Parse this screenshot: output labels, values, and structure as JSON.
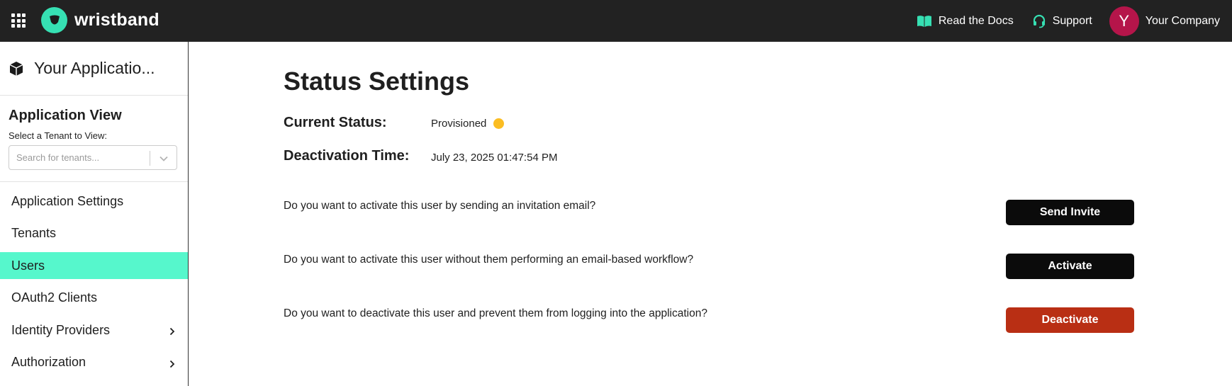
{
  "topbar": {
    "logo_text": "wristband",
    "links": [
      {
        "label": "Read the Docs",
        "icon": "book-icon"
      },
      {
        "label": "Support",
        "icon": "headset-icon"
      }
    ],
    "avatar_initial": "Y",
    "company_name": "Your Company",
    "avatar_color": "#b5154a",
    "accent_color": "#36e0b3"
  },
  "sidebar": {
    "app_name": "Your Applicatio...",
    "view_title": "Application View",
    "tenant_label": "Select a Tenant to View:",
    "tenant_placeholder": "Search for tenants...",
    "items": [
      {
        "label": "Application Settings",
        "active": false,
        "has_arrow": false
      },
      {
        "label": "Tenants",
        "active": false,
        "has_arrow": false
      },
      {
        "label": "Users",
        "active": true,
        "has_arrow": false
      },
      {
        "label": "OAuth2 Clients",
        "active": false,
        "has_arrow": false
      },
      {
        "label": "Identity Providers",
        "active": false,
        "has_arrow": true
      },
      {
        "label": "Authorization",
        "active": false,
        "has_arrow": true
      }
    ],
    "active_color": "#56f7cc"
  },
  "main": {
    "title": "Status Settings",
    "current_status_label": "Current Status:",
    "current_status_value": "Provisioned",
    "status_color": "#fbbd22",
    "deactivation_label": "Deactivation Time:",
    "deactivation_value": "July 23, 2025 01:47:54 PM",
    "actions": [
      {
        "question": "Do you want to activate this user by sending an invitation email?",
        "button": "Send Invite",
        "color": "#0b0b0b"
      },
      {
        "question": "Do you want to activate this user without them performing an email-based workflow?",
        "button": "Activate",
        "color": "#0b0b0b"
      },
      {
        "question": "Do you want to deactivate this user and prevent them from logging into the application?",
        "button": "Deactivate",
        "color": "#b92f14"
      }
    ]
  }
}
